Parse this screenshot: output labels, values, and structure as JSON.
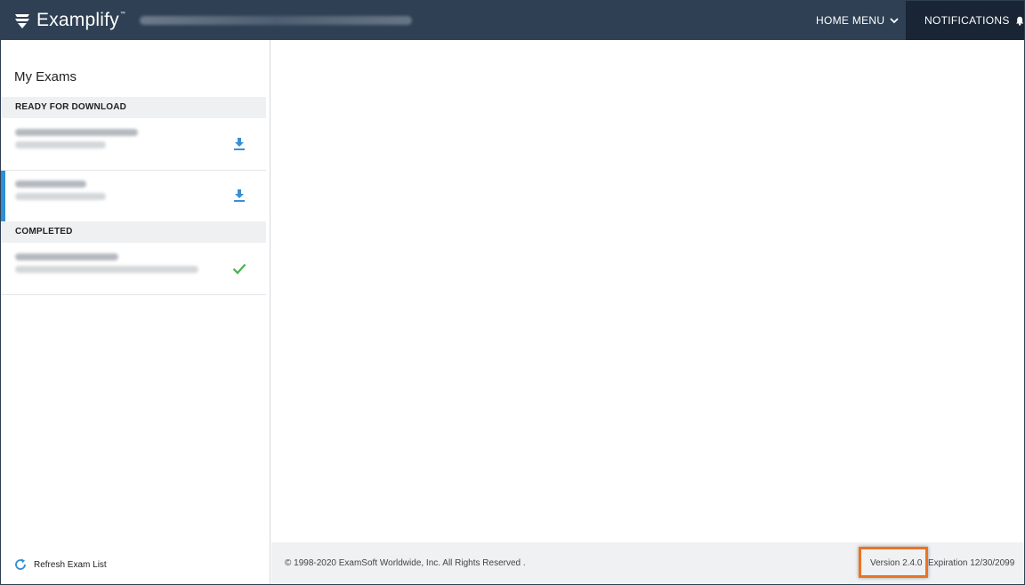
{
  "header": {
    "app_name": "Examplify",
    "trademark": "™",
    "home_menu_label": "HOME MENU",
    "notifications_label": "NOTIFICATIONS"
  },
  "sidebar": {
    "title": "My Exams",
    "sections": [
      {
        "label": "READY FOR DOWNLOAD"
      },
      {
        "label": "COMPLETED"
      }
    ],
    "refresh_label": "Refresh Exam List"
  },
  "footer": {
    "copyright": "© 1998-2020 ExamSoft Worldwide, Inc. All Rights Reserved .",
    "version": "Version 2.4.0",
    "expiration": "Expiration 12/30/2099"
  },
  "colors": {
    "header_bg": "#2f4054",
    "notifications_bg": "#192535",
    "accent_blue": "#2d8fd5",
    "download_icon": "#3a8fd6",
    "check_icon": "#4caf50",
    "highlight_box": "#ec7321"
  },
  "icons": {
    "logo": "examplify-logo-icon",
    "home_menu": "chevron-down-icon",
    "notifications": "bell-icon",
    "download": "download-icon",
    "completed": "check-icon",
    "refresh": "refresh-icon"
  }
}
